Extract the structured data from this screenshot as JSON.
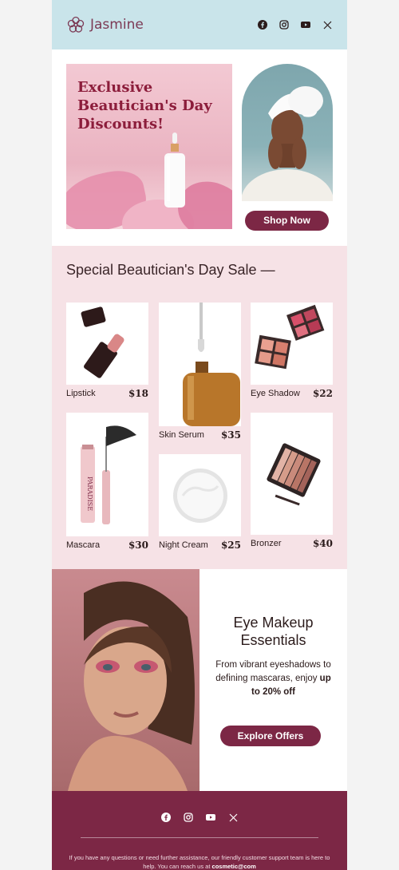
{
  "header": {
    "brand_name": "Jasmine",
    "social_icons": [
      "facebook-icon",
      "instagram-icon",
      "youtube-icon",
      "x-icon"
    ]
  },
  "hero": {
    "title_line1": "Exclusive",
    "title_line2": "Beautician's Day",
    "title_line3": "Discounts!",
    "button_label": "Shop Now"
  },
  "sale": {
    "title": "Special Beautician's Day Sale —",
    "products": [
      {
        "name": "Lipstick",
        "price": "$18"
      },
      {
        "name": "Skin Serum",
        "price": "$35"
      },
      {
        "name": "Eye Shadow",
        "price": "$22"
      },
      {
        "name": "Mascara",
        "price": "$30"
      },
      {
        "name": "Night Cream",
        "price": "$25"
      },
      {
        "name": "Bronzer",
        "price": "$40"
      }
    ]
  },
  "eye_makeup": {
    "title_line1": "Eye Makeup",
    "title_line2": "Essentials",
    "text_part1": "From vibrant eyeshadows to defining mascaras, enjoy ",
    "text_bold": "up to 20% off",
    "button_label": "Explore Offers"
  },
  "footer": {
    "note_text": "If you have any questions or need further assistance, our friendly customer support team is here to help. You can reach us at ",
    "note_email": "cosmetic@com"
  },
  "colors": {
    "header_bg": "#c9e4ea",
    "accent": "#7c2745",
    "sale_bg": "#f6e2e6",
    "hero_title": "#8c1d3b"
  }
}
